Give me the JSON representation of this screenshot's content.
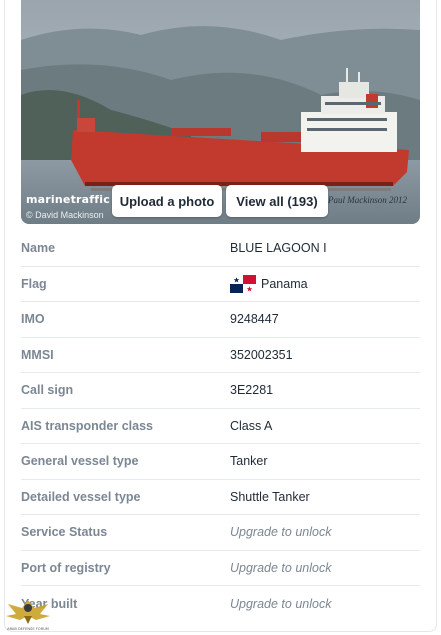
{
  "photo": {
    "brand": "marinetraffic",
    "credit": "© David Mackinson",
    "signature": "Paul Mackinson 2012",
    "upload_label": "Upload a photo",
    "view_all_label": "View all (193)"
  },
  "details": [
    {
      "label": "Name",
      "value": "BLUE LAGOON I"
    },
    {
      "label": "Flag",
      "value": "Panama",
      "icon": "panama-flag-icon"
    },
    {
      "label": "IMO",
      "value": "9248447"
    },
    {
      "label": "MMSI",
      "value": "352002351"
    },
    {
      "label": "Call sign",
      "value": "3E2281"
    },
    {
      "label": "AIS transponder class",
      "value": "Class A"
    },
    {
      "label": "General vessel type",
      "value": "Tanker"
    },
    {
      "label": "Detailed vessel type",
      "value": "Shuttle Tanker"
    },
    {
      "label": "Service Status",
      "value": "Upgrade to unlock"
    },
    {
      "label": "Port of registry",
      "value": "Upgrade to unlock"
    },
    {
      "label": "Year built",
      "value": "Upgrade to unlock"
    }
  ],
  "watermark": {
    "text": "ARAB DEFENSE FORUM"
  },
  "colors": {
    "label": "#7b8794",
    "value": "#1f2a36",
    "divider": "#e6e9ed",
    "hull_red": "#c23a2e"
  }
}
